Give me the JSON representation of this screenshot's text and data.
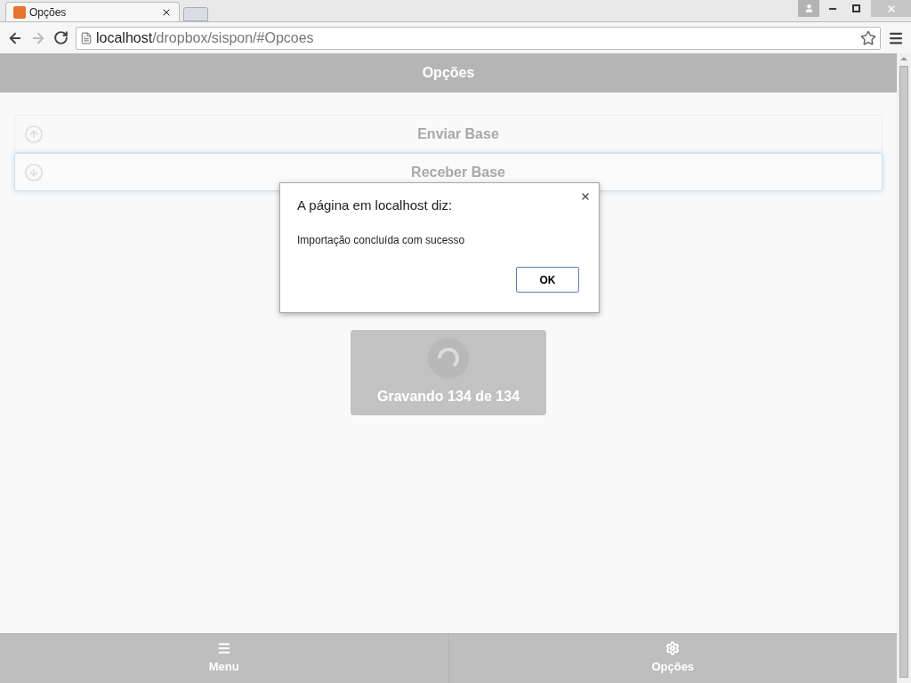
{
  "browser": {
    "tab_title": "Opções",
    "address_host": "localhost",
    "address_path": "/dropbox/sispon/#Opcoes"
  },
  "header": {
    "title": "Opções"
  },
  "list": [
    {
      "label": "Enviar Base",
      "kind": "upload",
      "focused": false
    },
    {
      "label": "Receber Base",
      "kind": "download",
      "focused": true
    }
  ],
  "loader": {
    "text": "Gravando 134 de 134"
  },
  "dialog": {
    "title": "A página em localhost diz:",
    "message": "Importação concluída com sucesso",
    "button": "OK"
  },
  "footer": [
    {
      "label": "Menu",
      "kind": "menu"
    },
    {
      "label": "Opções",
      "kind": "settings"
    }
  ]
}
